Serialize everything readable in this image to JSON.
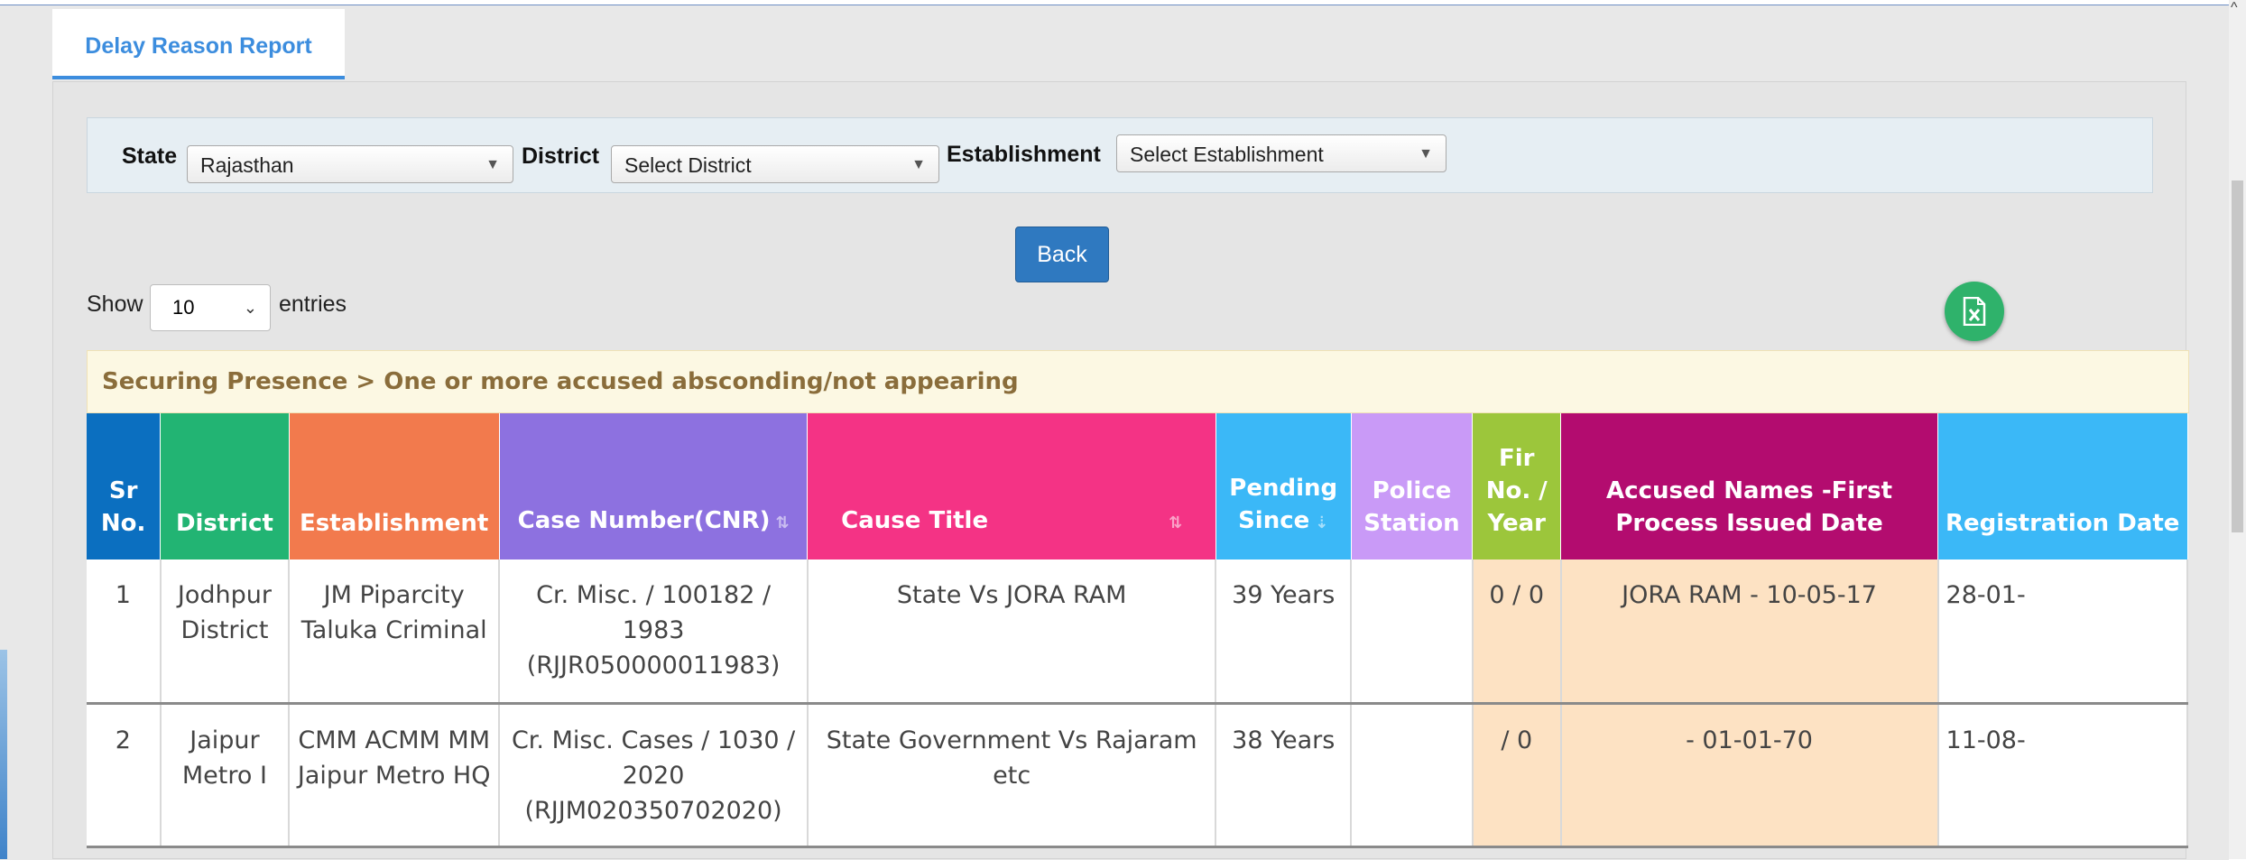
{
  "tab": {
    "label": "Delay Reason Report"
  },
  "filters": {
    "state_label": "State",
    "state_value": "Rajasthan",
    "district_label": "District",
    "district_value": "Select District",
    "establishment_label": "Establishment",
    "establishment_value": "Select Establishment"
  },
  "back_button": "Back",
  "show": {
    "prefix": "Show",
    "value": "10",
    "suffix": "entries"
  },
  "export_icon": "excel-icon",
  "table_title": "Securing Presence > One or more accused absconding/not appearing",
  "columns": [
    {
      "label": "Sr No.",
      "color": "#0b6fc0"
    },
    {
      "label": "District",
      "color": "#22b473"
    },
    {
      "label": "Establishment",
      "color": "#f27a4d"
    },
    {
      "label": "Case Number(CNR)",
      "color": "#8d71e0"
    },
    {
      "label": "Cause Title",
      "color": "#f43385"
    },
    {
      "label": "Pending Since",
      "color": "#3bb8f7"
    },
    {
      "label": "Police Station",
      "color": "#c99af7"
    },
    {
      "label": "Fir No. / Year",
      "color": "#9cc63b"
    },
    {
      "label": "Accused Names -First Process Issued Date",
      "color": "#b30c6f"
    },
    {
      "label": "Registration Date",
      "color": "#3bb8f7"
    }
  ],
  "rows": [
    {
      "sr": "1",
      "district": "Jodhpur District",
      "establishment": "JM Piparcity Taluka Criminal",
      "case": "Cr. Misc. / 100182 / 1983 (RJJR050000011983)",
      "cause": "State Vs JORA RAM",
      "pending": "39 Years",
      "police": "",
      "fir": "0 / 0",
      "accused": "JORA RAM - 10-05-17",
      "reg": "28-01-"
    },
    {
      "sr": "2",
      "district": "Jaipur Metro I",
      "establishment": "CMM ACMM MM Jaipur Metro HQ",
      "case": "Cr. Misc. Cases / 1030 / 2020 (RJJM020350702020)",
      "cause": "State Government Vs Rajaram etc",
      "pending": "38 Years",
      "police": "",
      "fir": "/ 0",
      "accused": "- 01-01-70",
      "reg": "11-08-"
    }
  ]
}
